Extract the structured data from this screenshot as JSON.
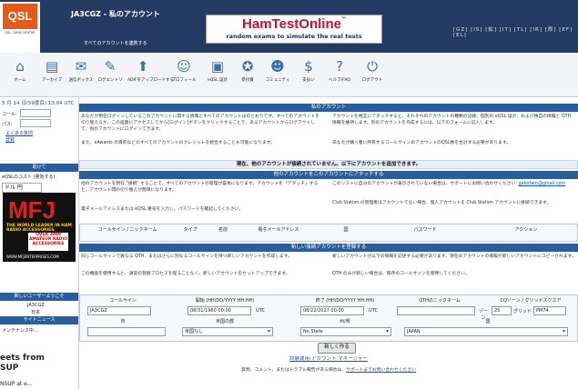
{
  "header": {
    "logo_text": "QSL",
    "logo_sub": "QSL CARD CENTRE",
    "title": "JA3CGZ - 私のアカウント",
    "subtitle": "すべてのアカウントを連携する",
    "ad_title": "HamTestOnline",
    "ad_tm": "™",
    "ad_sub": "random exams to simulate the real tests",
    "languages": "[GZ] [IS] [拡] [IT] [TL] [IR] [即] [EF] [EL]"
  },
  "nav": [
    {
      "icon": "home-icon",
      "glyph": "⌂",
      "label": "ホーム"
    },
    {
      "icon": "archive-icon",
      "glyph": "▤",
      "label": "アーカイブ"
    },
    {
      "icon": "outbox-icon",
      "glyph": "✉",
      "label": "送信ボックス"
    },
    {
      "icon": "logbook-icon",
      "glyph": "✎",
      "label": "ログエントリ"
    },
    {
      "icon": "upload-icon",
      "glyph": "⬆",
      "label": "ADIFをアップロードする"
    },
    {
      "icon": "profile-icon",
      "glyph": "☺",
      "label": "プロフィール"
    },
    {
      "icon": "eqsl-design-icon",
      "glyph": "▣",
      "label": "eQSL 設計"
    },
    {
      "icon": "award-icon",
      "glyph": "✪",
      "label": "受付賞"
    },
    {
      "icon": "community-icon",
      "glyph": "☻",
      "label": "コミュニティ"
    },
    {
      "icon": "payment-icon",
      "glyph": "$",
      "label": "支払い"
    },
    {
      "icon": "help-icon",
      "glyph": "?",
      "label": "ヘルプ/FAQ"
    },
    {
      "icon": "logout-icon",
      "glyph": "⏻",
      "label": "ログアウト"
    }
  ],
  "left": {
    "date": "5 月 14 日(59度目) 13:04 UTC",
    "label_a": "コール:",
    "label_b": "パス:",
    "link_1": "よくある質問",
    "link_2": "登録",
    "sec_1": "助けて",
    "text_1": "eQSLのコスト (発効する)",
    "donate": "ドル 円",
    "mfj_big": "MFJ",
    "mfj_t1": "THE WORLD LEADER IN HAM RADIO ACCESSORIES",
    "mfj_t2": "OVER 2000 AMATEUR RADIO ACCESSORIES",
    "mfj_url": "WWW.MFJENTERPRISES.COM",
    "sec_2": "新しいユーザーようこそ",
    "new_user_1": "JA3CGZ",
    "new_user_2": "日本",
    "sec_3": "サイトニュース",
    "news_text": "メンテナンス中...",
    "tweets": "eets from",
    "tweets_2": "SUP",
    "tweet_3": "NSUP at e..."
  },
  "main": {
    "bar_account": "私のアカウント",
    "text_left": "あなたが現在ログインしているこのアカウントに関する情報とすべてのアカウントはのとおりです。すべてのアカウントを切り替えるか、この画面にアクセスしてから[ログイン]ボタンをクリックすることで、あるアカウントからログアウトして、別のアカウントにログインできます。",
    "text_left_2": "また、eAwards の目的などのすべてのアカウントのクレジットを統合することも可能になります。",
    "text_right": "アカウントを相互にアタッチすると、それぞれのアカウントの種類の記録、個別の eQSL 設計、および独自の情報と QTH 情報を維持します。別のアカウントを作成するには、以下のフォームに記入します。",
    "text_right_2": "あなたが購入者に所有するコールサインのアカウントのQSL数を合計する必要があります。",
    "notice": "現在、他のアカウントが接続されていません。以下にアカウントを追加できます。",
    "bar_attach": "他のアカウントをこのアカウントにアタッチする",
    "attach_text_l": "他のアカウントを現在 \"接続\" することで、すべてのアカウントの管理が容易になります。アカウントを「アタッチ」すると、アカウント間の切り替えが簡単になります。",
    "attach_text_l2": "電子メールアドレスまたは eQSL 番号を入力し、パスワードを確認してください。",
    "attach_text_r": "このリストに自分のアカウントが表示されていない場合は、サポートにお問い合わせください:",
    "attach_email": "gabotarn@gmail.com",
    "attach_text_r2": "Club Station の管理者はアカウントでない場合、個人アカウントを Club Station アカウントに接続できます。",
    "attach_headers": [
      "コールサイン / ニックネーム",
      "タイプ",
      "名前",
      "電子メールアドレス",
      "国",
      "パスワード",
      "アクション"
    ],
    "bar_new": "新しい接続アカウントを登録する",
    "new_text_l": "同じコールサインで異なる QTH、またはさらに別なるコールサインを持つ新しいアカウントを作成します。",
    "new_text_l2": "この機能を使用すると、通常の登録プロセスを経ることなく、新しいアカウントをセットアップできます。",
    "new_text_r": "新しいアカウントが以下の情報を記述する必要があります。現在のアカウントの情報が新しいアカウントにコピーされます。",
    "new_text_r2": "QTH のみが新しい場合は、既存のコールサインを使用してください。",
    "form_headers": [
      "コールサイン",
      "開始 (HH/DD/YYYY HH:HH)",
      "終了 (HH/DD/YYYY HH:HH)",
      "QTHのニックネーム",
      "CQゾーン / グリッドスクエア"
    ],
    "callsign": "JA3CGZ",
    "start": "08/31/1960 00:00",
    "end": "08/22/2027 00:00",
    "utc": "UTC",
    "qth_nick": "",
    "zone_label": "ゾーン",
    "zone": "25",
    "grid_label": "グリッド",
    "grid": "PM74",
    "form_headers_2": [
      "市",
      "米国の郡",
      "州/県",
      "国"
    ],
    "city": "",
    "county": "米国なし",
    "state": "No State",
    "country": "JAPAN",
    "create_button": "新しく作る",
    "footer_link": "試験運用-アカウント マネージャー",
    "footer_text": "質問、コメント、またはトラブル報告がある場合は、",
    "footer_link_2": "サポートまでお問い合わせください"
  }
}
